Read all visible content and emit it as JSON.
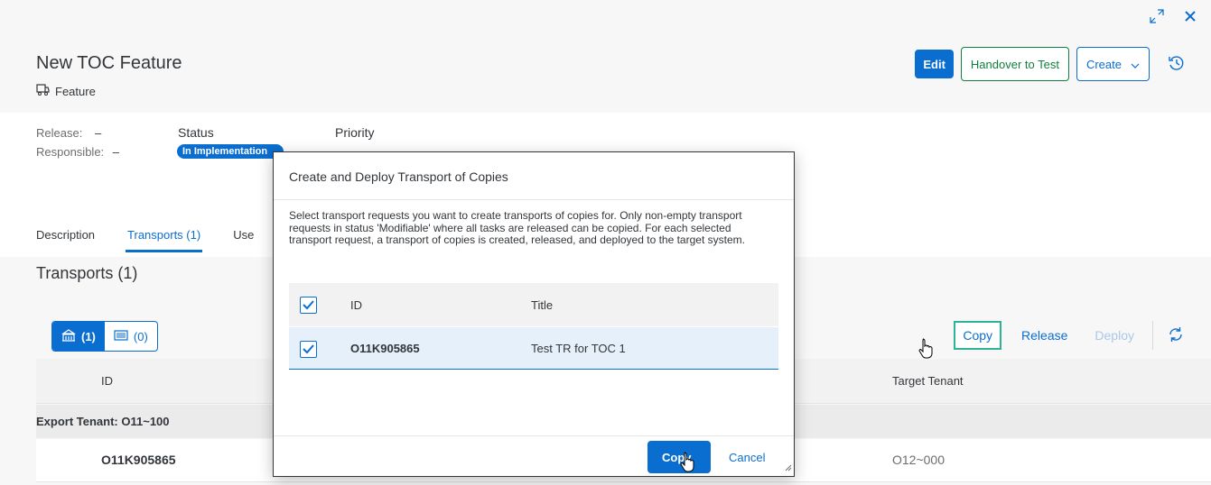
{
  "header": {
    "title": "New TOC Feature",
    "object_type": "Feature",
    "actions": {
      "edit": "Edit",
      "handover": "Handover to Test",
      "create": "Create"
    }
  },
  "attributes": {
    "release_label": "Release:",
    "release_value": "–",
    "responsible_label": "Responsible:",
    "responsible_value": "–",
    "status_label": "Status",
    "status_value": "In Implementation",
    "priority_label": "Priority"
  },
  "tabs": [
    "Description",
    "Transports (1)",
    "Use"
  ],
  "section": {
    "title": "Transports (1)",
    "segments": [
      {
        "label": "(1)",
        "icon": "building-icon"
      },
      {
        "label": "(0)",
        "icon": "server-icon"
      }
    ],
    "toolbar": {
      "copy": "Copy",
      "release": "Release",
      "deploy": "Deploy"
    },
    "columns": {
      "id": "ID",
      "target": "Target Tenant"
    },
    "group_label": "Export Tenant: O11~100",
    "row": {
      "id": "O11K905865",
      "target": "O12~000"
    }
  },
  "dialog": {
    "title": "Create and Deploy Transport of Copies",
    "text": "Select transport requests you want to create transports of copies for. Only non-empty transport requests in status 'Modifiable' where all tasks are released can be copied. For each selected transport request, a transport of copies is created, released, and deployed to the target system.",
    "columns": {
      "id": "ID",
      "title": "Title"
    },
    "row": {
      "id": "O11K905865",
      "title": "Test TR for TOC 1"
    },
    "buttons": {
      "copy": "Copy",
      "cancel": "Cancel"
    }
  },
  "colors": {
    "accent": "#0a6ed1",
    "positive": "#107e3e",
    "highlight": "#2bb594"
  }
}
